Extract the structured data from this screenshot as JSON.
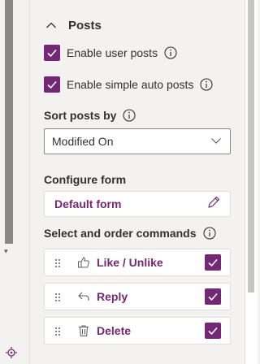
{
  "colors": {
    "accent": "#742774",
    "panel_bg": "#f3f2f1",
    "text": "#323130",
    "border": "#8a8886"
  },
  "posts_section": {
    "title": "Posts",
    "expanded": true,
    "toggle_icon": "chevron-up-icon"
  },
  "options": [
    {
      "label": "Enable user posts",
      "checked": true,
      "info_icon": "info-icon"
    },
    {
      "label": "Enable simple auto posts",
      "checked": true,
      "info_icon": "info-icon"
    }
  ],
  "sort": {
    "label": "Sort posts by",
    "value": "Modified On",
    "dropdown_icon": "chevron-down-icon"
  },
  "configure_form": {
    "label": "Configure form",
    "button_label": "Default form",
    "edit_icon": "pencil-icon"
  },
  "commands": {
    "label": "Select and order commands",
    "items": [
      {
        "label": "Like / Unlike",
        "icon": "thumbs-up-icon",
        "checked": true
      },
      {
        "label": "Reply",
        "icon": "reply-icon",
        "checked": true
      },
      {
        "label": "Delete",
        "icon": "trash-icon",
        "checked": true
      }
    ]
  }
}
